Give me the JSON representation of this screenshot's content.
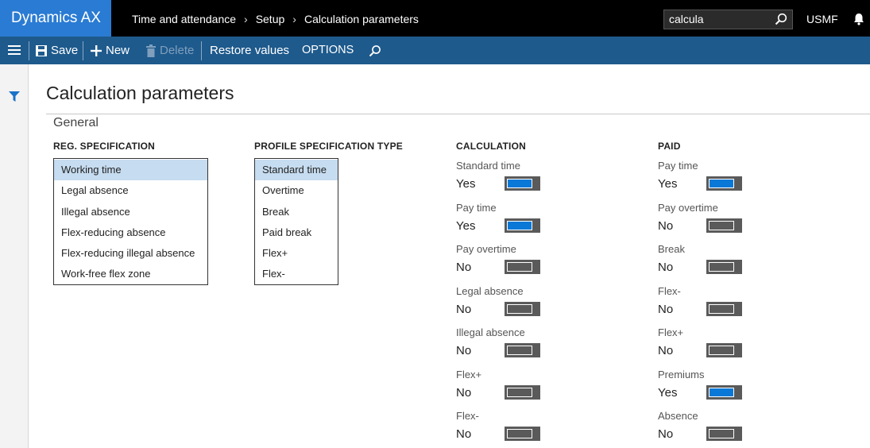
{
  "app": {
    "title": "Dynamics AX",
    "company": "USMF"
  },
  "breadcrumb": [
    "Time and attendance",
    "Setup",
    "Calculation parameters"
  ],
  "search": {
    "value": "calcula"
  },
  "actions": {
    "save": "Save",
    "new": "New",
    "delete": "Delete",
    "restore": "Restore values",
    "options": "OPTIONS"
  },
  "page": {
    "title": "Calculation parameters",
    "section": "General"
  },
  "reg_spec": {
    "header": "REG. SPECIFICATION",
    "items": [
      "Working time",
      "Legal absence",
      "Illegal absence",
      "Flex-reducing absence",
      "Flex-reducing illegal absence",
      "Work-free flex zone"
    ],
    "selected": 0
  },
  "profile_spec": {
    "header": "PROFILE SPECIFICATION TYPE",
    "items": [
      "Standard time",
      "Overtime",
      "Break",
      "Paid break",
      "Flex+",
      "Flex-"
    ],
    "selected": 0
  },
  "calculation": {
    "header": "CALCULATION",
    "fields": [
      {
        "label": "Standard time",
        "value": "Yes",
        "on": true
      },
      {
        "label": "Pay time",
        "value": "Yes",
        "on": true
      },
      {
        "label": "Pay overtime",
        "value": "No",
        "on": false
      },
      {
        "label": "Legal absence",
        "value": "No",
        "on": false
      },
      {
        "label": "Illegal absence",
        "value": "No",
        "on": false
      },
      {
        "label": "Flex+",
        "value": "No",
        "on": false
      },
      {
        "label": "Flex-",
        "value": "No",
        "on": false
      }
    ]
  },
  "paid": {
    "header": "PAID",
    "fields": [
      {
        "label": "Pay time",
        "value": "Yes",
        "on": true
      },
      {
        "label": "Pay overtime",
        "value": "No",
        "on": false
      },
      {
        "label": "Break",
        "value": "No",
        "on": false
      },
      {
        "label": "Flex-",
        "value": "No",
        "on": false
      },
      {
        "label": "Flex+",
        "value": "No",
        "on": false
      },
      {
        "label": "Premiums",
        "value": "Yes",
        "on": true
      },
      {
        "label": "Absence",
        "value": "No",
        "on": false
      }
    ]
  },
  "colors": {
    "brand": "#2a7bd3",
    "actionbar": "#1e5a8c",
    "toggle_on": "#0a78d7",
    "selected_row": "#c6dcf0"
  }
}
